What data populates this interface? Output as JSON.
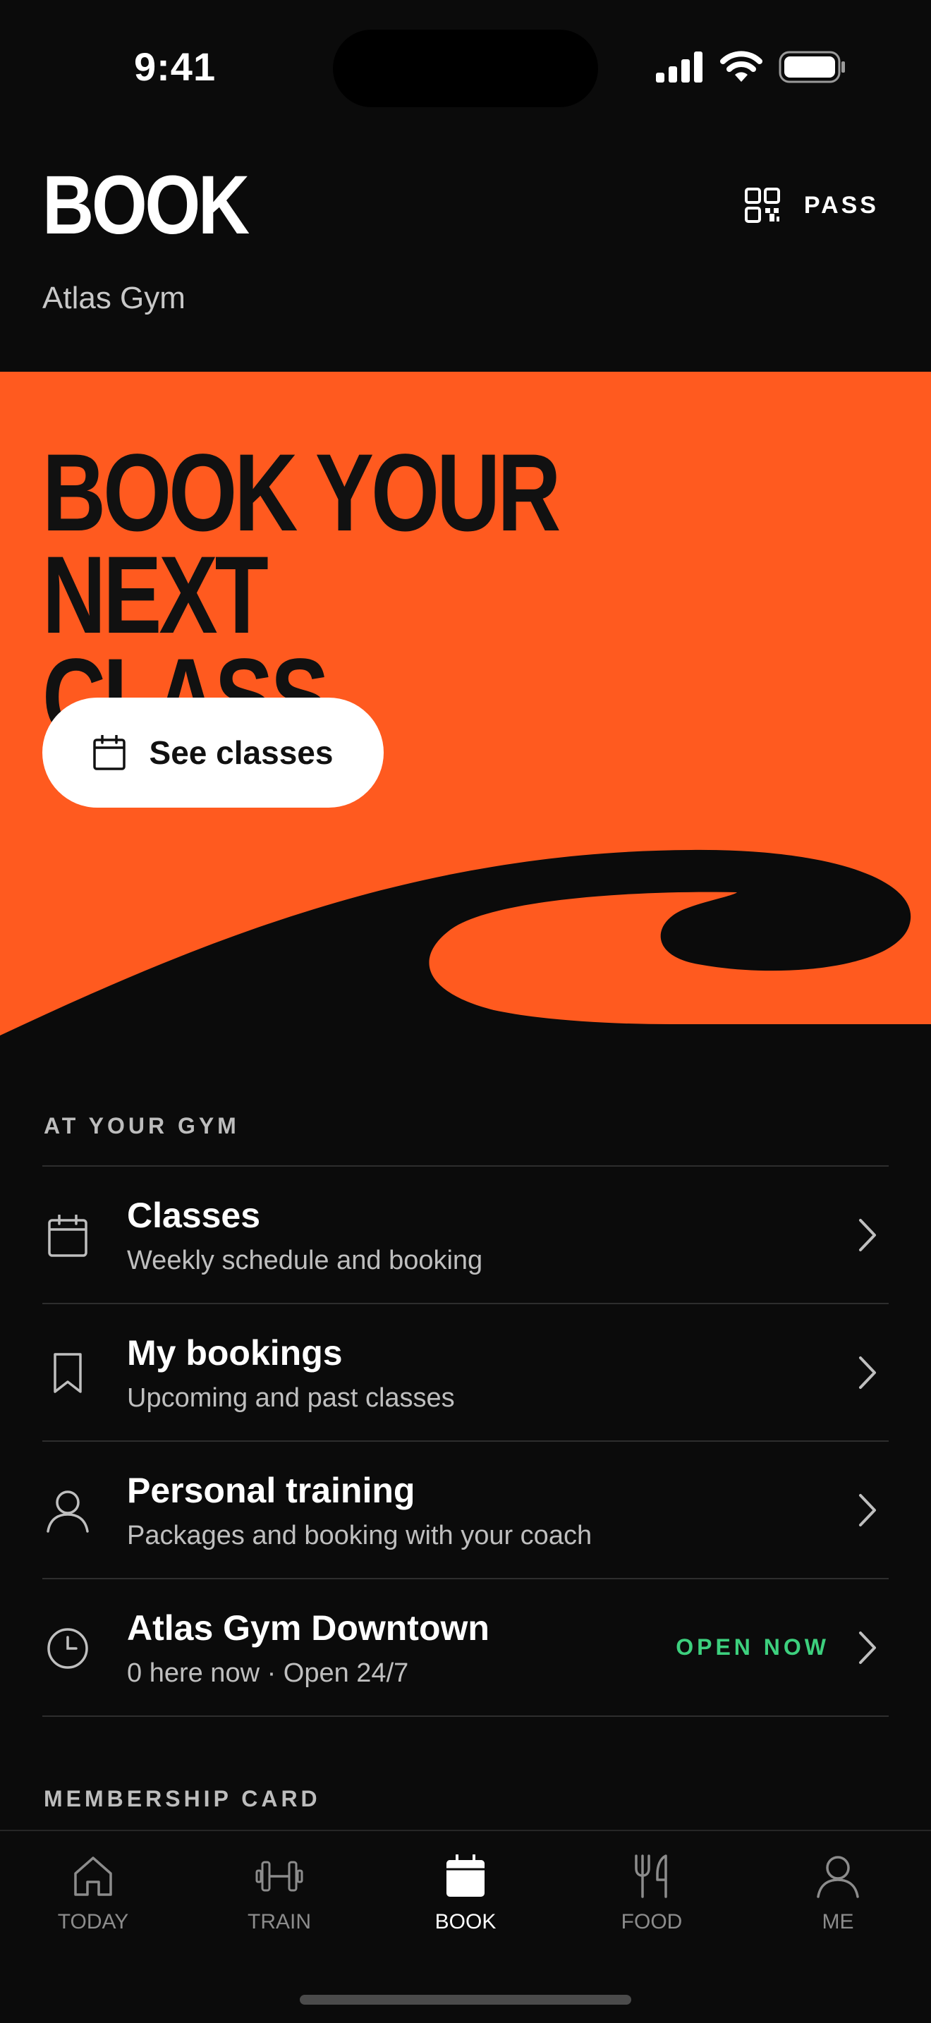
{
  "status_bar": {
    "time": "9:41"
  },
  "header": {
    "title": "BOOK",
    "subtitle": "Atlas Gym",
    "pass_label": "PASS"
  },
  "hero": {
    "headline_line1": "BOOK YOUR NEXT",
    "headline_line2": "CLASS",
    "cta_label": "See classes",
    "background_color": "#ff5a1f"
  },
  "gym_section": {
    "label": "AT YOUR GYM",
    "items": [
      {
        "title": "Classes",
        "subtitle": "Weekly schedule and booking",
        "icon": "calendar-icon"
      },
      {
        "title": "My bookings",
        "subtitle": "Upcoming and past classes",
        "icon": "bookmark-icon"
      },
      {
        "title": "Personal training",
        "subtitle": "Packages and booking with your coach",
        "icon": "person-icon"
      },
      {
        "title": "Atlas Gym Downtown",
        "subtitle": "0 here now · Open 24/7",
        "status": "OPEN NOW",
        "status_color": "#3dd07e",
        "icon": "clock-icon"
      }
    ]
  },
  "membership_section": {
    "label": "MEMBERSHIP CARD"
  },
  "tab_bar": {
    "active": "BOOK",
    "tabs": [
      {
        "label": "TODAY",
        "icon": "home-icon"
      },
      {
        "label": "TRAIN",
        "icon": "dumbbell-icon"
      },
      {
        "label": "BOOK",
        "icon": "calendar-icon"
      },
      {
        "label": "FOOD",
        "icon": "fork-knife-icon"
      },
      {
        "label": "ME",
        "icon": "person-icon"
      }
    ]
  }
}
